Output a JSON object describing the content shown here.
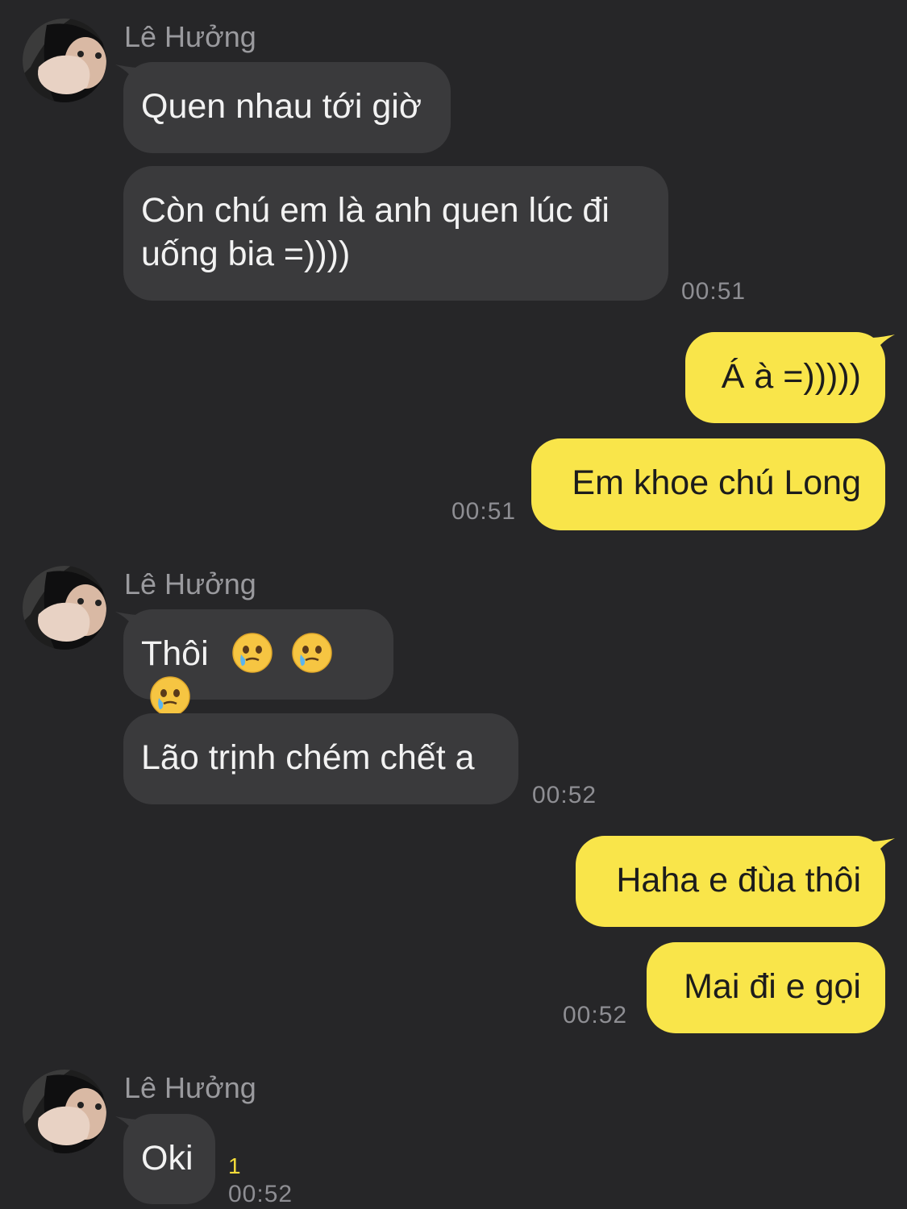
{
  "colors": {
    "background": "#262628",
    "incoming_bubble": "#3a3a3c",
    "outgoing_bubble": "#f9e54a",
    "timestamp": "#8e8e93",
    "unread_count": "#f4dc3a"
  },
  "groups": [
    {
      "sender": "Lê Hưởng",
      "messages": [
        "Quen nhau tới giờ",
        "Còn chú em là anh quen lúc đi uống bia =))))"
      ],
      "time": "00:51"
    },
    {
      "messages": [
        "Á à =)))))",
        "Em khoe chú Long"
      ],
      "time": "00:51"
    },
    {
      "sender": "Lê Hưởng",
      "messages": [
        "Thôi",
        "Lão trịnh chém chết a"
      ],
      "time": "00:52",
      "emoji": "face-holding-back-tears-icon"
    },
    {
      "messages": [
        "Haha e đùa thôi",
        "Mai đi e gọi"
      ],
      "time": "00:52"
    },
    {
      "sender": "Lê Hưởng",
      "messages": [
        "Oki"
      ],
      "time": "00:52",
      "unread": "1"
    }
  ]
}
